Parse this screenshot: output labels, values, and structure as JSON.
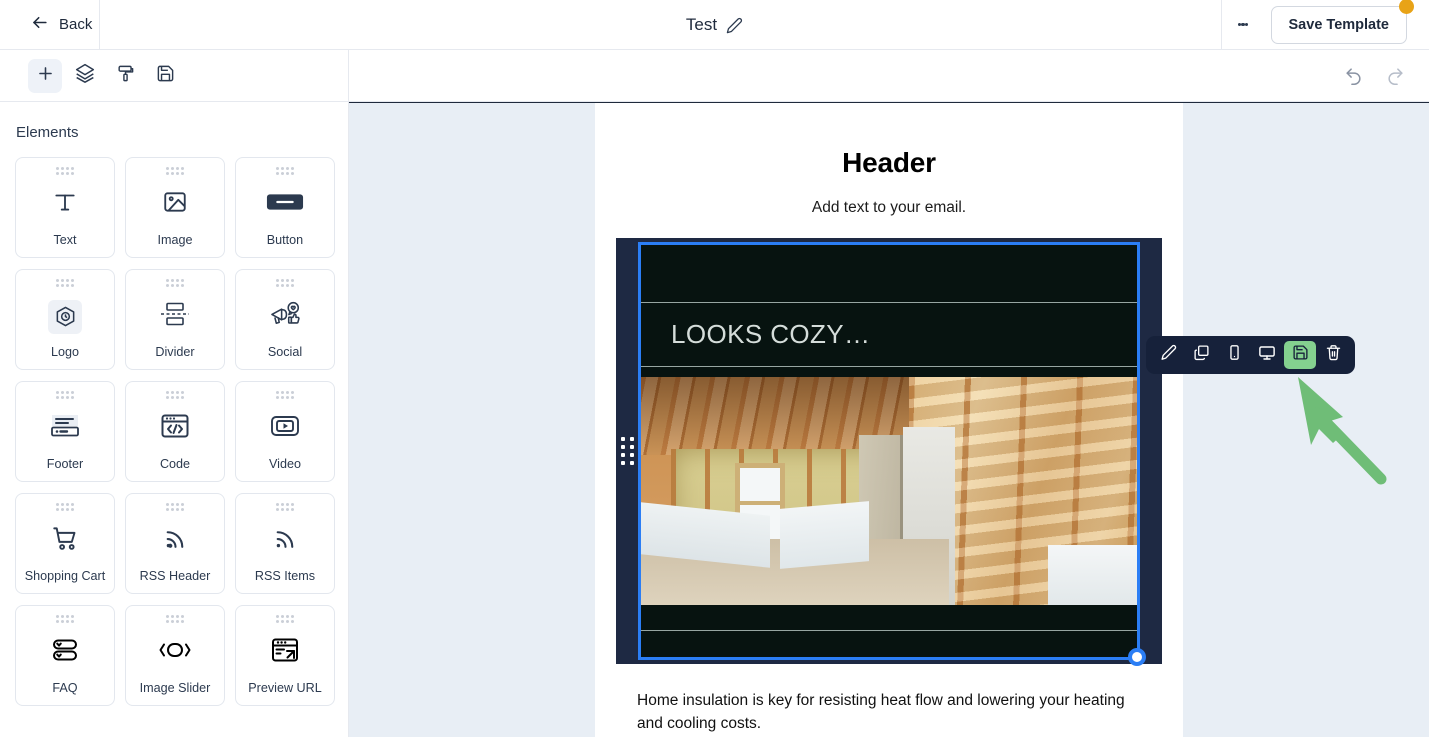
{
  "topbar": {
    "back_label": "Back",
    "title": "Test",
    "edit_icon": "pencil-icon",
    "menu_icon": "kebab-menu-icon",
    "save_template_label": "Save Template",
    "badge": ""
  },
  "toolbar": {
    "buttons": [
      {
        "name": "add-element",
        "icon": "plus-icon",
        "active": true
      },
      {
        "name": "layers",
        "icon": "layers-icon",
        "active": false
      },
      {
        "name": "styles",
        "icon": "paint-roller-icon",
        "active": false
      },
      {
        "name": "save",
        "icon": "floppy-disk-icon",
        "active": false
      }
    ],
    "undo_icon": "undo-arrow-icon",
    "redo_icon": "redo-arrow-icon"
  },
  "panel": {
    "title": "Elements",
    "items": [
      {
        "label": "Text",
        "icon": "text-t-icon"
      },
      {
        "label": "Image",
        "icon": "image-picture-icon"
      },
      {
        "label": "Button",
        "icon": "button-pill-icon"
      },
      {
        "label": "Logo",
        "icon": "logo-hexagon-icon"
      },
      {
        "label": "Divider",
        "icon": "divider-icon"
      },
      {
        "label": "Social",
        "icon": "social-megaphone-icon"
      },
      {
        "label": "Footer",
        "icon": "footer-icon"
      },
      {
        "label": "Code",
        "icon": "code-brackets-icon"
      },
      {
        "label": "Video",
        "icon": "video-play-icon"
      },
      {
        "label": "Shopping Cart",
        "icon": "shopping-cart-icon"
      },
      {
        "label": "RSS Header",
        "icon": "rss-feed-icon"
      },
      {
        "label": "RSS Items",
        "icon": "rss-feed-icon"
      },
      {
        "label": "FAQ",
        "icon": "faq-accordion-icon"
      },
      {
        "label": "Image Slider",
        "icon": "image-slider-icon"
      },
      {
        "label": "Preview URL",
        "icon": "preview-url-icon"
      }
    ]
  },
  "email": {
    "heading": "Header",
    "subheading": "Add text to your email.",
    "banner_text": "LOOKS COZY…",
    "body_text": "Home insulation is key for resisting heat flow and lowering your heating and cooling costs."
  },
  "element_toolbar": {
    "buttons": [
      {
        "name": "edit",
        "icon": "pencil-icon",
        "highlighted": false
      },
      {
        "name": "duplicate",
        "icon": "duplicate-copy-icon",
        "highlighted": false
      },
      {
        "name": "mobile-view",
        "icon": "mobile-phone-icon",
        "highlighted": false
      },
      {
        "name": "desktop-view",
        "icon": "desktop-monitor-icon",
        "highlighted": false
      },
      {
        "name": "save-block",
        "icon": "floppy-disk-icon",
        "highlighted": true
      },
      {
        "name": "delete",
        "icon": "trash-can-icon",
        "highlighted": false
      }
    ]
  },
  "annotation": {
    "type": "arrow",
    "points_to": "save-block-button",
    "color": "#6fbd77"
  },
  "colors": {
    "accent_blue": "#2b7ef5",
    "badge_orange": "#e8a317",
    "highlight_green": "#84d18f",
    "canvas_bg": "#e8eef5",
    "dark_navy": "#16213a"
  }
}
